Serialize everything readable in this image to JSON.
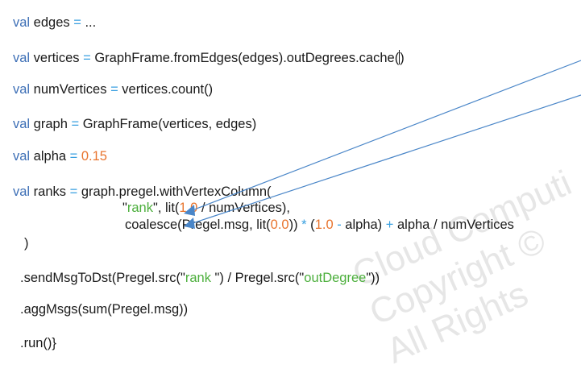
{
  "watermark": {
    "line1": "Cloud Computi",
    "line2": "Copyright ©",
    "line3": "All Rights"
  },
  "code": {
    "l1": {
      "kw": "val",
      "name": " edges ",
      "op": "=",
      "rest": " ..."
    },
    "l2": {
      "kw": "val",
      "name": " vertices ",
      "op": "=",
      "rest": " GraphFrame.fromEdges(edges).outDegrees.cache(",
      "close": ")"
    },
    "l3": {
      "kw": "val",
      "name": " numVertices ",
      "op": "=",
      "rest": " vertices.count()"
    },
    "l4": {
      "kw": "val",
      "name": " graph ",
      "op": "=",
      "rest": " GraphFrame(vertices, edges)"
    },
    "l5": {
      "kw": "val",
      "name": " alpha ",
      "op": "=",
      "sp": " ",
      "num": "0.15"
    },
    "l6": {
      "kw": "val",
      "name": " ranks ",
      "op": "=",
      "rest": " graph.pregel.withVertexColumn("
    },
    "l7": {
      "q1": "\"",
      "str": "rank",
      "q2": "\"",
      "a": ", lit(",
      "num": "1.0",
      "b": " / numVertices),"
    },
    "l8": {
      "a": "coalesce(Pregel.msg, lit(",
      "num1": "0.0",
      "b": ")) ",
      "op1": "*",
      "c": " (",
      "num2": "1.0",
      "d": " ",
      "op2": "-",
      "e": " alpha) ",
      "op3": "+",
      "f": " alpha / numVertices"
    },
    "l9": {
      "text": ")"
    },
    "l10": {
      "a": ".sendMsgToDst(Pregel.src(\"",
      "str1": "rank ",
      "b": "\") / Pregel.src(\"",
      "str2": "outDegree",
      "c": "\"))"
    },
    "l11": {
      "text": ".aggMsgs(sum(Pregel.msg))"
    },
    "l12": {
      "text": ".run()}"
    }
  },
  "colors": {
    "keyword": "#3d6fb6",
    "operator": "#3aa0e0",
    "number": "#e8742e",
    "string": "#4caf3c",
    "arrow": "#4a86c8"
  }
}
